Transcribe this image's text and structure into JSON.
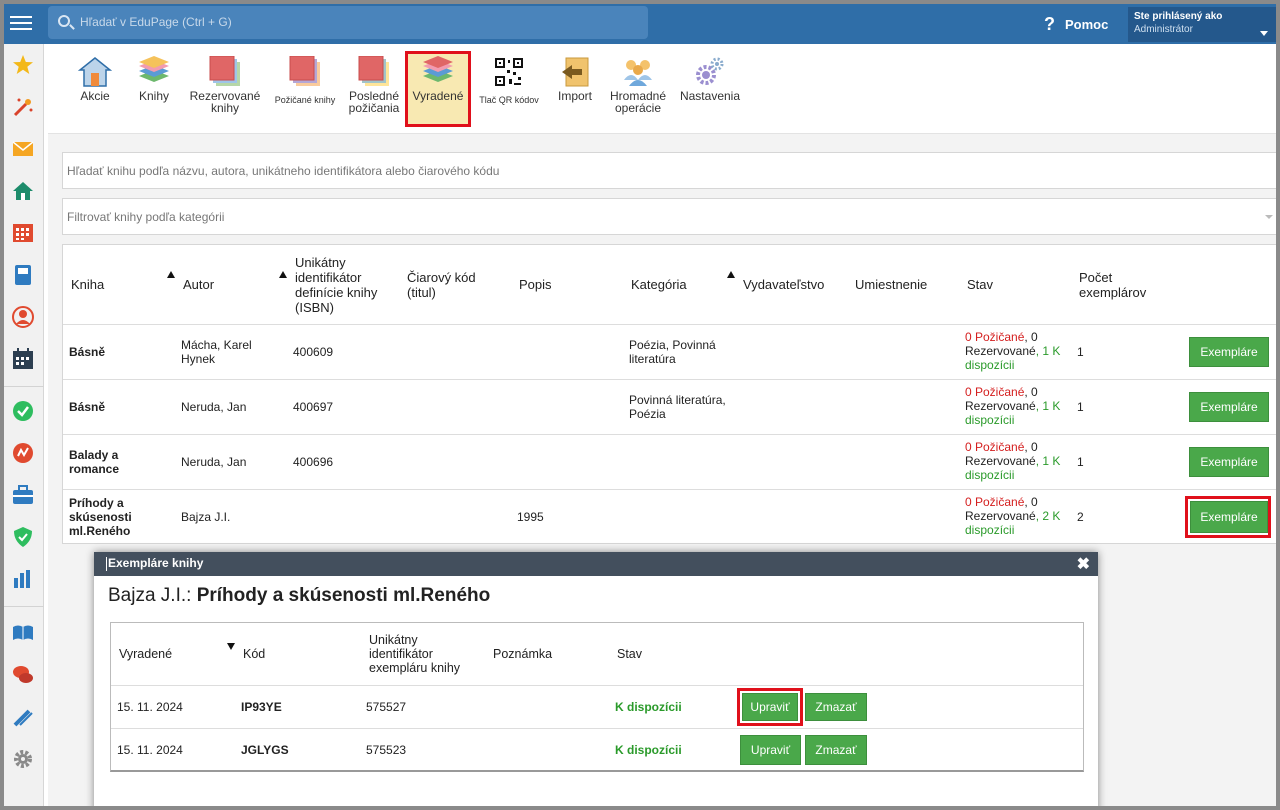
{
  "topbar": {
    "search_placeholder": "Hľadať v EduPage (Ctrl + G)",
    "help_label": "Pomoc",
    "help_icon": "?",
    "user_line1": "Ste prihlásený ako",
    "user_line2": "Administrátor"
  },
  "toolbar": {
    "items": [
      {
        "label": "Akcie",
        "icon": "house-door-icon"
      },
      {
        "label": "Knihy",
        "icon": "books-stack-icon"
      },
      {
        "label": "Rezervované knihy",
        "icon": "reserved-books-icon"
      },
      {
        "label": "Požičané knihy",
        "icon": "borrowed-books-icon"
      },
      {
        "label": "Posledné požičania",
        "icon": "recent-loans-icon"
      },
      {
        "label": "Vyradené",
        "icon": "discarded-books-icon"
      },
      {
        "label": "Tlač QR kódov",
        "icon": "qr-code-icon"
      },
      {
        "label": "Import",
        "icon": "import-icon"
      },
      {
        "label": "Hromadné operácie",
        "icon": "group-users-icon"
      },
      {
        "label": "Nastavenia",
        "icon": "gears-icon"
      }
    ]
  },
  "filters": {
    "search_placeholder": "Hľadať knihu podľa názvu, autora, unikátneho identifikátora alebo čiarového kódu",
    "category_placeholder": "Filtrovať knihy podľa kategórii"
  },
  "books_table": {
    "headers": {
      "kniha": "Kniha",
      "autor": "Autor",
      "isbn": "Unikátny identifikátor definície knihy (ISBN)",
      "barcode": "Čiarový kód (titul)",
      "popis": "Popis",
      "kategoria": "Kategória",
      "vydavatelstvo": "Vydavateľstvo",
      "umiestnenie": "Umiestnenie",
      "stav": "Stav",
      "pocet": "Počet exemplárov"
    },
    "button_label": "Exempláre",
    "rows": [
      {
        "title": "Básně",
        "author": "Mácha, Karel Hynek",
        "isbn": "400609",
        "popis": "",
        "category": "Poézia, Povinná literatúra",
        "borrowed": "0 Požičané",
        "reserved_prefix": ", 0",
        "reserved": "Rezervované",
        "available_prefix": ", 1 K",
        "available": "dispozícii",
        "count": "1"
      },
      {
        "title": "Básně",
        "author": "Neruda, Jan",
        "isbn": "400697",
        "popis": "",
        "category": "Povinná literatúra, Poézia",
        "borrowed": "0 Požičané",
        "reserved_prefix": ", 0",
        "reserved": "Rezervované",
        "available_prefix": ", 1 K",
        "available": "dispozícii",
        "count": "1"
      },
      {
        "title": "Balady a romance",
        "author": "Neruda, Jan",
        "isbn": "400696",
        "popis": "",
        "category": "",
        "borrowed": "0 Požičané",
        "reserved_prefix": ", 0",
        "reserved": "Rezervované",
        "available_prefix": ", 1 K",
        "available": "dispozícii",
        "count": "1"
      },
      {
        "title": "Príhody a skúsenosti ml.Reného",
        "author": "Bajza J.I.",
        "isbn": "",
        "popis": "1995",
        "category": "",
        "borrowed": "0 Požičané",
        "reserved_prefix": ", 0",
        "reserved": "Rezervované",
        "available_prefix": ", 2 K",
        "available": "dispozícii",
        "count": "2"
      }
    ]
  },
  "dialog": {
    "header": "Exempláre knihy",
    "close_glyph": "✖",
    "author": "Bajza J.I.:",
    "title": "Príhody a skúsenosti ml.Reného",
    "headers": {
      "vyradene": "Vyradené",
      "kod": "Kód",
      "id": "Unikátny identifikátor exempláru knihy",
      "poznamka": "Poznámka",
      "stav": "Stav"
    },
    "edit_label": "Upraviť",
    "delete_label": "Zmazať",
    "rows": [
      {
        "date": "15. 11. 2024",
        "code": "IP93YE",
        "id": "575527",
        "note": "",
        "status": "K dispozícii"
      },
      {
        "date": "15. 11. 2024",
        "code": "JGLYGS",
        "id": "575523",
        "note": "",
        "status": "K dispozícii"
      }
    ]
  },
  "colors": {
    "topbar": "#2f6ea8",
    "accent_green": "#4aa84a",
    "highlight_red": "#e0101b",
    "active_tab_bg": "#f8e9b2"
  }
}
